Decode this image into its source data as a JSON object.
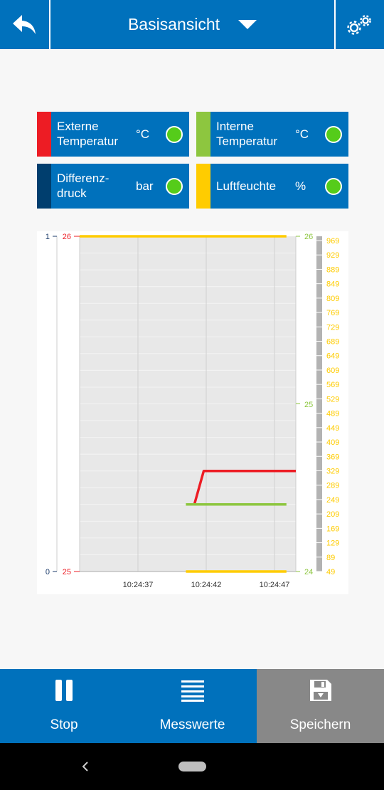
{
  "header": {
    "title": "Basisansicht",
    "back_icon": "back-arrow-icon",
    "settings_icon": "gears-icon"
  },
  "sensors": [
    {
      "name": "Externe Temperatur",
      "line1": "Externe",
      "line2": "Temperatur",
      "unit": "°C",
      "color": "#ed1c24"
    },
    {
      "name": "Interne Temperatur",
      "line1": "Interne",
      "line2": "Temperatur",
      "unit": "°C",
      "color": "#8dc63f"
    },
    {
      "name": "Differenzdruck",
      "line1": "Differenz-",
      "line2": "druck",
      "unit": "bar",
      "color": "#003e6e"
    },
    {
      "name": "Luftfeuchte",
      "line1": "Luftfeuchte",
      "line2": "",
      "unit": "%",
      "color": "#ffcc00"
    }
  ],
  "chart_data": {
    "type": "line",
    "x_ticks": [
      "10:24:37",
      "10:24:42",
      "10:24:47"
    ],
    "x_range_seconds": [
      28,
      51
    ],
    "axes": {
      "pressure": {
        "ticks": [
          "1",
          "0"
        ],
        "range": [
          0,
          1
        ],
        "color": "#1a3a6a"
      },
      "ext_temp": {
        "ticks": [
          "26",
          "25"
        ],
        "range": [
          25,
          26
        ],
        "color": "#ed1c24"
      },
      "int_temp": {
        "ticks": [
          "26",
          "25",
          "24"
        ],
        "range": [
          24,
          26
        ],
        "color": "#8dc63f"
      },
      "humidity": {
        "ticks": [
          "969",
          "929",
          "889",
          "849",
          "809",
          "769",
          "729",
          "689",
          "649",
          "609",
          "569",
          "529",
          "489",
          "449",
          "409",
          "369",
          "329",
          "289",
          "249",
          "209",
          "169",
          "129",
          "89",
          "49"
        ],
        "range": [
          49,
          969
        ],
        "color": "#ffcc00"
      }
    },
    "series": [
      {
        "name": "Externe Temperatur",
        "axis": "ext_temp",
        "color": "#ed1c24",
        "points": [
          [
            40.2,
            25.2
          ],
          [
            41.2,
            25.3
          ],
          [
            51,
            25.3
          ]
        ]
      },
      {
        "name": "Interne Temperatur",
        "axis": "int_temp",
        "color": "#8dc63f",
        "points": [
          [
            39.3,
            24.4
          ],
          [
            50,
            24.4
          ]
        ]
      },
      {
        "name": "Luftfeuchte",
        "axis": "humidity",
        "color": "#ffcc00",
        "points": [
          [
            28,
            969
          ],
          [
            50,
            969
          ]
        ]
      },
      {
        "name": "Luftfeuchte",
        "axis": "humidity",
        "color": "#ffcc00",
        "points": [
          [
            39.3,
            49
          ],
          [
            50,
            49
          ]
        ]
      }
    ]
  },
  "bottom_tabs": [
    {
      "label": "Stop",
      "icon": "pause-icon"
    },
    {
      "label": "Messwerte",
      "icon": "list-icon"
    },
    {
      "label": "Speichern",
      "icon": "save-icon"
    }
  ]
}
